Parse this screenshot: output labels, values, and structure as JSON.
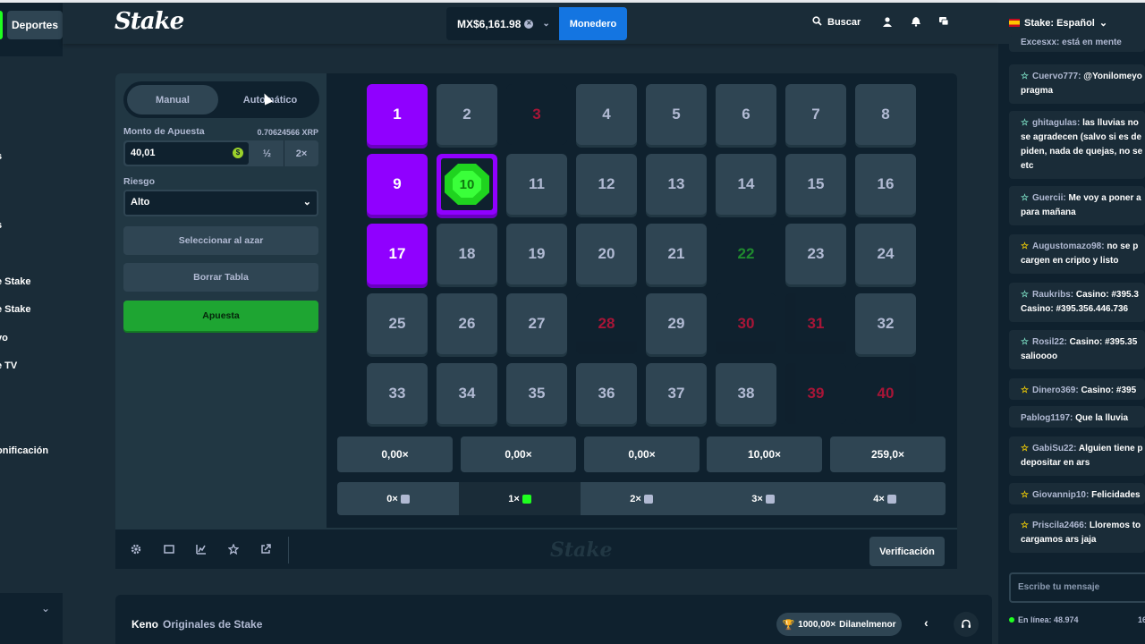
{
  "header": {
    "logo": "Stake",
    "balance": "MX$6,161.98",
    "wallet_label": "Monedero",
    "search_label": "Buscar"
  },
  "left_sidebar": {
    "sports_label": "Deportes",
    "items": [
      "s",
      "s",
      "e Stake",
      "e Stake",
      "vo",
      "e TV",
      "onificación"
    ]
  },
  "controls": {
    "mode_manual": "Manual",
    "mode_auto": "Automático",
    "active_mode": "Manual",
    "bet_label": "Monto de Apuesta",
    "bet_crypto": "0.70624566 XRP",
    "bet_value": "40,01",
    "half_label": "½",
    "double_label": "2×",
    "risk_label": "Riesgo",
    "risk_value": "Alto",
    "random_label": "Seleccionar al azar",
    "clear_label": "Borrar Tabla",
    "bet_button": "Apuesta"
  },
  "board": {
    "tiles": [
      "1",
      "2",
      "3",
      "4",
      "5",
      "6",
      "7",
      "8",
      "9",
      "10",
      "11",
      "12",
      "13",
      "14",
      "15",
      "16",
      "17",
      "18",
      "19",
      "20",
      "21",
      "22",
      "23",
      "24",
      "25",
      "26",
      "27",
      "28",
      "29",
      "30",
      "31",
      "32",
      "33",
      "34",
      "35",
      "36",
      "37",
      "38",
      "39",
      "40"
    ],
    "selected": [
      "1",
      "9",
      "17"
    ],
    "hit": [
      "10"
    ],
    "drawn_miss": [
      "3",
      "28",
      "30",
      "31",
      "39",
      "40"
    ],
    "drawn_green": [
      "22"
    ]
  },
  "payouts": [
    "0,00×",
    "0,00×",
    "0,00×",
    "10,00×",
    "259,0×"
  ],
  "hits": [
    {
      "label": "0×",
      "active": false
    },
    {
      "label": "1×",
      "active": true
    },
    {
      "label": "2×",
      "active": false
    },
    {
      "label": "3×",
      "active": false
    },
    {
      "label": "4×",
      "active": false
    }
  ],
  "footer": {
    "logo": "Stake",
    "verify_label": "Verificación"
  },
  "info_bar": {
    "title": "Keno",
    "subtitle": "Originales de Stake",
    "winner_multiplier": "1000,00×",
    "winner_name": "Dilanelmenor"
  },
  "chat": {
    "language": "Stake: Español",
    "messages": [
      {
        "user": "",
        "text": "Excesxx: está en mente",
        "star": ""
      },
      {
        "user": "Cuervo777:",
        "text": "@Yonilomeyo pragma",
        "star": "teal"
      },
      {
        "user": "ghitagulas:",
        "text": "las lluvias no se agradecen (salvo si es de piden, nada de quejas, no se etc",
        "star": "teal"
      },
      {
        "user": "Guercii:",
        "text": "Me voy a poner a para mañana",
        "star": "teal"
      },
      {
        "user": "Augustomazo98:",
        "text": "no se p cargen en cripto y listo",
        "star": "gold"
      },
      {
        "user": "Raukribs:",
        "text": "Casino: #395.3 Casino: #395.356.446.736",
        "star": "teal"
      },
      {
        "user": "Rosil22:",
        "text": "Casino: #395.35 salioooo",
        "star": "teal"
      },
      {
        "user": "Dinero369:",
        "text": "Casino: #395",
        "star": "gold"
      },
      {
        "user": "Pablog1197:",
        "text": "Que la lluvia",
        "star": ""
      },
      {
        "user": "GabiSu22:",
        "text": "Alguien tiene p depositar en ars",
        "star": "gold"
      },
      {
        "user": "Giovannip10:",
        "text": "Felicidades",
        "star": "gold"
      },
      {
        "user": "Priscila2466:",
        "text": "Lloremos to cargamos ars jaja",
        "star": "gold"
      }
    ],
    "input_placeholder": "Escribe tu mensaje",
    "online_label": "En línea: 48.974",
    "online_extra": "16"
  },
  "colors": {
    "accent_purple": "#9000ff",
    "accent_green": "#1fff20",
    "bet_green": "#1ea532",
    "wallet_blue": "#1475e1",
    "miss_red": "#e9113c"
  }
}
